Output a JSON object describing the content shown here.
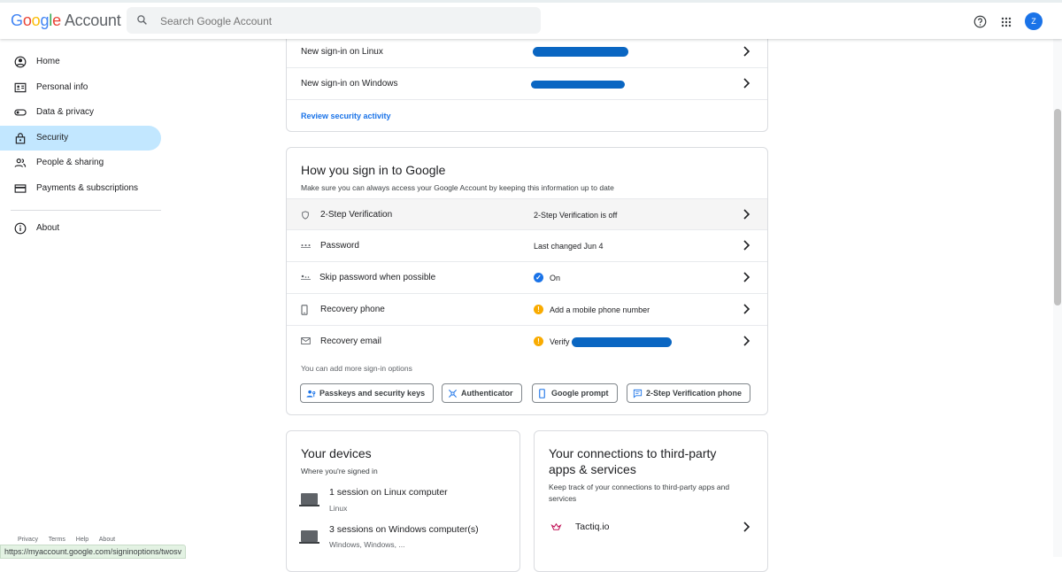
{
  "header": {
    "logo_letters": [
      "G",
      "o",
      "o",
      "g",
      "l",
      "e"
    ],
    "logo_suffix": "Account",
    "search_placeholder": "Search Google Account",
    "avatar_initial": "Z"
  },
  "sidebar": {
    "items": [
      {
        "label": "Home",
        "icon": "home-icon"
      },
      {
        "label": "Personal info",
        "icon": "id-card-icon"
      },
      {
        "label": "Data & privacy",
        "icon": "toggle-icon"
      },
      {
        "label": "Security",
        "icon": "lock-icon",
        "active": true
      },
      {
        "label": "People & sharing",
        "icon": "people-icon"
      },
      {
        "label": "Payments & subscriptions",
        "icon": "card-icon"
      }
    ],
    "about": "About",
    "footer": [
      "Privacy",
      "Terms",
      "Help",
      "About"
    ]
  },
  "activity": {
    "rows": [
      {
        "label": "New sign-in on Linux"
      },
      {
        "label": "New sign-in on Windows"
      }
    ],
    "review_link": "Review security activity"
  },
  "signin": {
    "title": "How you sign in to Google",
    "subtitle": "Make sure you can always access your Google Account by keeping this information up to date",
    "rows": [
      {
        "label": "2-Step Verification",
        "value": "2-Step Verification is off"
      },
      {
        "label": "Password",
        "value": "Last changed Jun 4"
      },
      {
        "label": "Skip password when possible",
        "value": "On"
      },
      {
        "label": "Recovery phone",
        "value": "Add a mobile phone number"
      },
      {
        "label": "Recovery email",
        "value": "Verify"
      }
    ],
    "more_options": "You can add more sign-in options",
    "chips": [
      "Passkeys and security keys",
      "Authenticator",
      "Google prompt",
      "2-Step Verification phone"
    ]
  },
  "devices": {
    "title": "Your devices",
    "subtitle": "Where you're signed in",
    "items": [
      {
        "title": "1 session on Linux computer",
        "sub": "Linux"
      },
      {
        "title": "3 sessions on Windows computer(s)",
        "sub": "Windows, Windows, ..."
      }
    ]
  },
  "connections": {
    "title_line1": "Your connections to third-party",
    "title_line2": "apps & services",
    "subtitle_line1": "Keep track of your connections to third-party apps and",
    "subtitle_line2": "services",
    "app": "Tactiq.io"
  },
  "status_url": "https://myaccount.google.com/signinoptions/twosv",
  "colors": {
    "accent": "#1a73e8",
    "active_nav": "#c2e7ff",
    "warning": "#f9ab00",
    "redaction": "#0a66c2"
  }
}
